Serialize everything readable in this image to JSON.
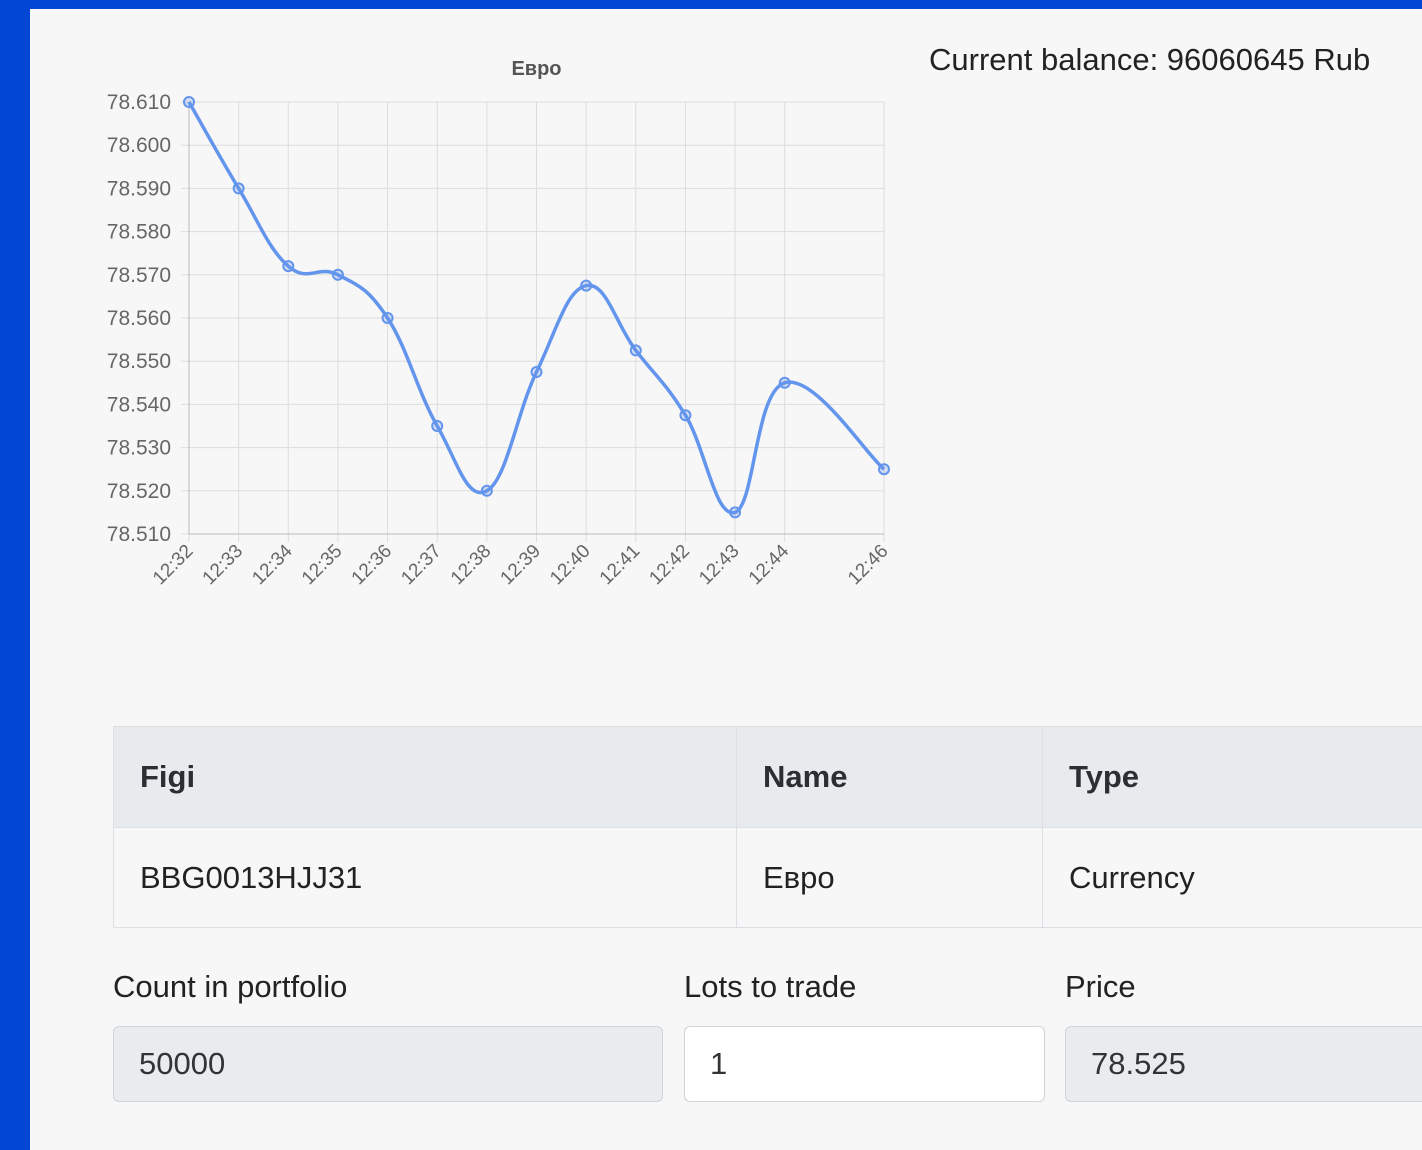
{
  "balance_text": "Current balance: 96060645 Rub",
  "chart_data": {
    "type": "line",
    "title": "Евро",
    "x": [
      "12:32",
      "12:33",
      "12:34",
      "12:35",
      "12:36",
      "12:37",
      "12:38",
      "12:39",
      "12:40",
      "12:41",
      "12:42",
      "12:43",
      "12:44",
      "12:46"
    ],
    "xlabel": "",
    "ylabel": "",
    "series": [
      {
        "values": [
          78.61,
          78.59,
          78.572,
          78.57,
          78.56,
          78.535,
          78.52,
          78.5475,
          78.5675,
          78.5525,
          78.5375,
          78.515,
          78.545,
          78.525
        ]
      }
    ],
    "ylim": [
      78.51,
      78.61
    ],
    "yticks": [
      "78.610",
      "78.600",
      "78.590",
      "78.580",
      "78.570",
      "78.560",
      "78.550",
      "78.540",
      "78.530",
      "78.520",
      "78.510"
    ],
    "grid": true,
    "line_color": "#6495ed"
  },
  "table": {
    "headers": [
      "Figi",
      "Name",
      "Type"
    ],
    "rows": [
      [
        "BBG0013HJJ31",
        "Евро",
        "Currency"
      ]
    ]
  },
  "form": {
    "count_label": "Count in portfolio",
    "count_value": "50000",
    "lots_label": "Lots to trade",
    "lots_value": "1",
    "price_label": "Price",
    "price_value": "78.525"
  }
}
